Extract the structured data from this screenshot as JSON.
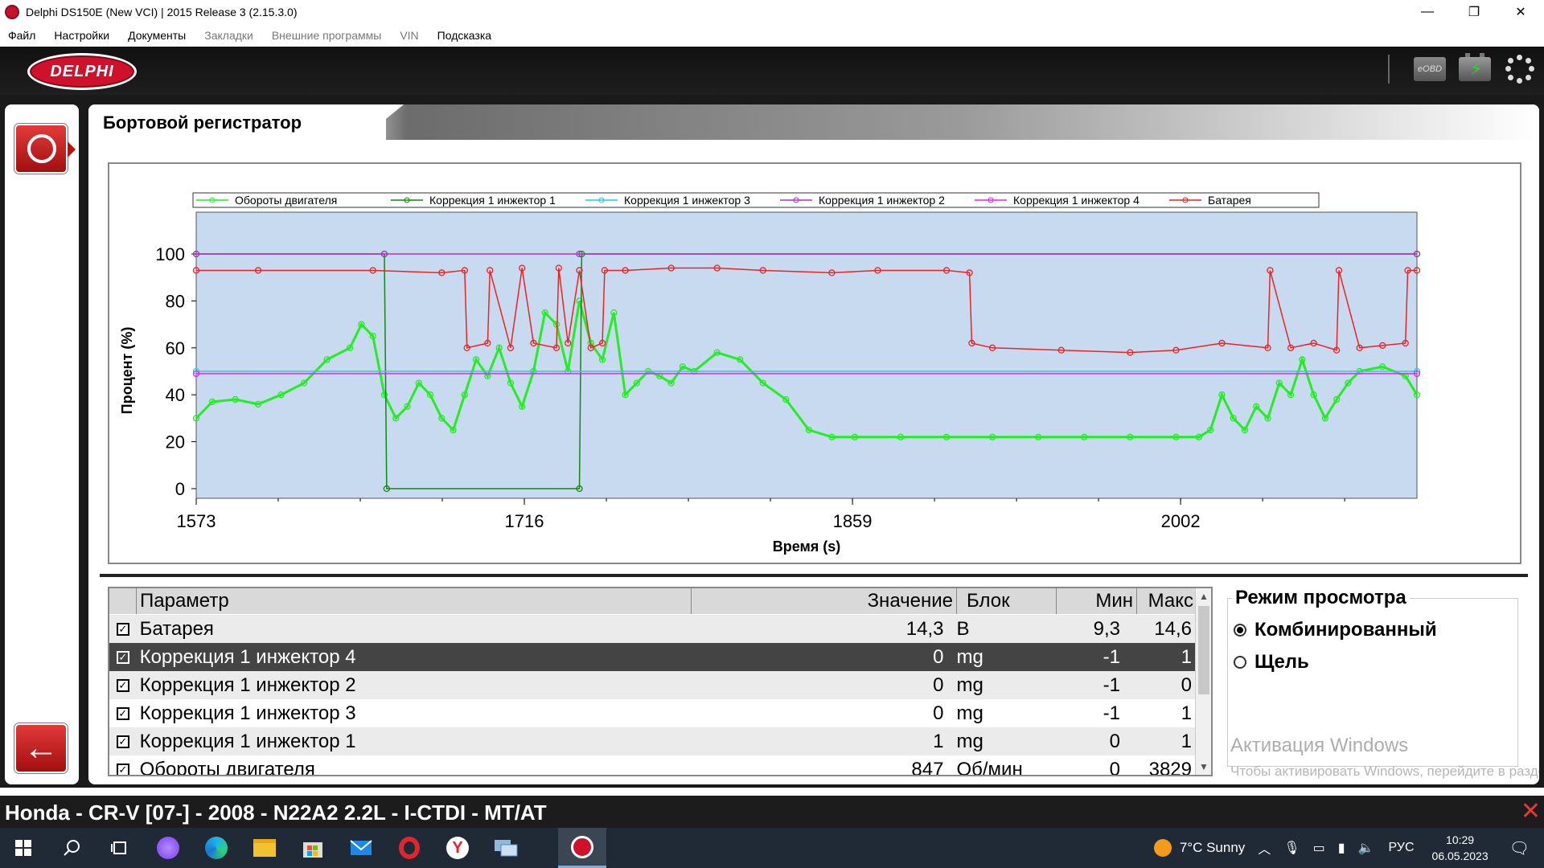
{
  "window": {
    "title": "Delphi DS150E (New VCI) | 2015 Release 3 (2.15.3.0)",
    "minimize": "—",
    "maximize": "❐",
    "close": "✕"
  },
  "menu": [
    {
      "label": "Файл",
      "enabled": true
    },
    {
      "label": "Настройки",
      "enabled": true
    },
    {
      "label": "Документы",
      "enabled": true
    },
    {
      "label": "Закладки",
      "enabled": false
    },
    {
      "label": "Внешние программы",
      "enabled": false
    },
    {
      "label": "VIN",
      "enabled": false
    },
    {
      "label": "Подсказка",
      "enabled": true
    }
  ],
  "header": {
    "logo_text": "DELPHI",
    "eobd_label": "eOBD"
  },
  "page": {
    "title": "Бортовой регистратор"
  },
  "chart_data": {
    "type": "line",
    "xlabel": "Время (s)",
    "ylabel": "Процент (%)",
    "ylim": [
      0,
      100
    ],
    "xlim": [
      1573,
      2105
    ],
    "yticks": [
      0,
      20,
      40,
      60,
      80,
      100
    ],
    "xticks": [
      1573,
      1716,
      1859,
      2002
    ],
    "grid": false,
    "legend_position": "top",
    "background": "#c8daf0",
    "series": [
      {
        "name": "Обороты двигателя",
        "color": "#22ee22",
        "marker": "triangle-down",
        "x": [
          1573,
          1580,
          1590,
          1600,
          1610,
          1620,
          1630,
          1640,
          1645,
          1650,
          1655,
          1660,
          1665,
          1670,
          1675,
          1680,
          1685,
          1690,
          1695,
          1700,
          1705,
          1710,
          1715,
          1720,
          1725,
          1730,
          1735,
          1740,
          1745,
          1750,
          1755,
          1760,
          1765,
          1770,
          1775,
          1780,
          1785,
          1790,
          1800,
          1810,
          1820,
          1830,
          1840,
          1850,
          1860,
          1880,
          1900,
          1920,
          1940,
          1960,
          1980,
          2000,
          2010,
          2015,
          2020,
          2025,
          2030,
          2035,
          2040,
          2045,
          2050,
          2055,
          2060,
          2065,
          2070,
          2075,
          2080,
          2090,
          2100,
          2105
        ],
        "y": [
          30,
          37,
          38,
          36,
          40,
          45,
          55,
          60,
          70,
          65,
          40,
          30,
          35,
          45,
          40,
          30,
          25,
          40,
          55,
          48,
          60,
          45,
          35,
          50,
          75,
          70,
          50,
          80,
          62,
          55,
          75,
          40,
          45,
          50,
          48,
          45,
          52,
          50,
          58,
          55,
          45,
          38,
          25,
          22,
          22,
          22,
          22,
          22,
          22,
          22,
          22,
          22,
          22,
          25,
          40,
          30,
          25,
          35,
          30,
          45,
          40,
          55,
          40,
          30,
          38,
          45,
          50,
          52,
          48,
          40
        ]
      },
      {
        "name": "Коррекция 1 инжектор 1",
        "color": "#118811",
        "marker": "circle",
        "x": [
          1573,
          1655,
          1656,
          1740,
          1741,
          2105
        ],
        "y": [
          100,
          100,
          0,
          0,
          100,
          100
        ]
      },
      {
        "name": "Коррекция 1 инжектор 3",
        "color": "#22ccee",
        "marker": "plus",
        "x": [
          1573,
          2105
        ],
        "y": [
          50,
          50
        ]
      },
      {
        "name": "Коррекция 1 инжектор 2",
        "color": "#aa33cc",
        "marker": "cross",
        "x": [
          1573,
          1655,
          1740,
          2105
        ],
        "y": [
          100,
          100,
          100,
          100
        ]
      },
      {
        "name": "Коррекция 1 инжектор 4",
        "color": "#ee22ee",
        "marker": "star",
        "x": [
          1573,
          2105
        ],
        "y": [
          49,
          49
        ]
      },
      {
        "name": "Батарея",
        "color": "#ee2222",
        "marker": "diamond",
        "x": [
          1573,
          1600,
          1650,
          1680,
          1690,
          1691,
          1700,
          1701,
          1710,
          1715,
          1720,
          1730,
          1731,
          1735,
          1740,
          1745,
          1750,
          1751,
          1760,
          1780,
          1800,
          1820,
          1850,
          1870,
          1900,
          1910,
          1911,
          1920,
          1950,
          1980,
          2000,
          2020,
          2040,
          2041,
          2050,
          2060,
          2070,
          2071,
          2080,
          2090,
          2100,
          2101,
          2105
        ],
        "y": [
          93,
          93,
          93,
          92,
          93,
          60,
          62,
          93,
          60,
          94,
          62,
          60,
          94,
          62,
          93,
          60,
          62,
          93,
          93,
          94,
          94,
          93,
          92,
          93,
          93,
          92,
          62,
          60,
          59,
          58,
          59,
          62,
          60,
          93,
          60,
          62,
          59,
          93,
          60,
          61,
          62,
          93,
          93
        ]
      }
    ]
  },
  "table": {
    "headers": {
      "param": "Параметр",
      "value": "Значение",
      "unit": "Блок",
      "min": "Мин",
      "max": "Макс"
    },
    "rows": [
      {
        "checked": "☑",
        "param": "Батарея",
        "value": "14,3",
        "unit": "В",
        "min": "9,3",
        "max": "14,6",
        "selected": false
      },
      {
        "checked": "☑",
        "param": "Коррекция 1 инжектор 4",
        "value": "0",
        "unit": "mg",
        "min": "-1",
        "max": "1",
        "selected": true
      },
      {
        "checked": "☑",
        "param": "Коррекция 1 инжектор 2",
        "value": "0",
        "unit": "mg",
        "min": "-1",
        "max": "0",
        "selected": false
      },
      {
        "checked": "☑",
        "param": "Коррекция 1 инжектор 3",
        "value": "0",
        "unit": "mg",
        "min": "-1",
        "max": "1",
        "selected": false
      },
      {
        "checked": "☑",
        "param": "Коррекция 1 инжектор 1",
        "value": "1",
        "unit": "mg",
        "min": "0",
        "max": "1",
        "selected": false
      },
      {
        "checked": "☑",
        "param": "Обороты двигателя",
        "value": "847",
        "unit": "Об/мин",
        "min": "0",
        "max": "3829",
        "selected": false
      }
    ]
  },
  "view_mode": {
    "title": "Режим просмотра",
    "options": [
      {
        "label": "Комбинированный",
        "selected": true
      },
      {
        "label": "Щель",
        "selected": false
      }
    ]
  },
  "watermark": {
    "line1": "Активация Windows",
    "line2": "Чтобы активировать Windows, перейдите в раздел \"Параметры\"."
  },
  "vehicle": {
    "label": "Honda - CR-V [07-] - 2008 - N22A2 2.2L - I-CTDI - MT/AT"
  },
  "taskbar": {
    "weather": "7°C  Sunny",
    "lang": "РУС",
    "time": "10:29",
    "date": "06.05.2023"
  },
  "colors": {
    "accent_red": "#d0112b",
    "header_black": "#111111",
    "plot_bg": "#c8daf0"
  }
}
